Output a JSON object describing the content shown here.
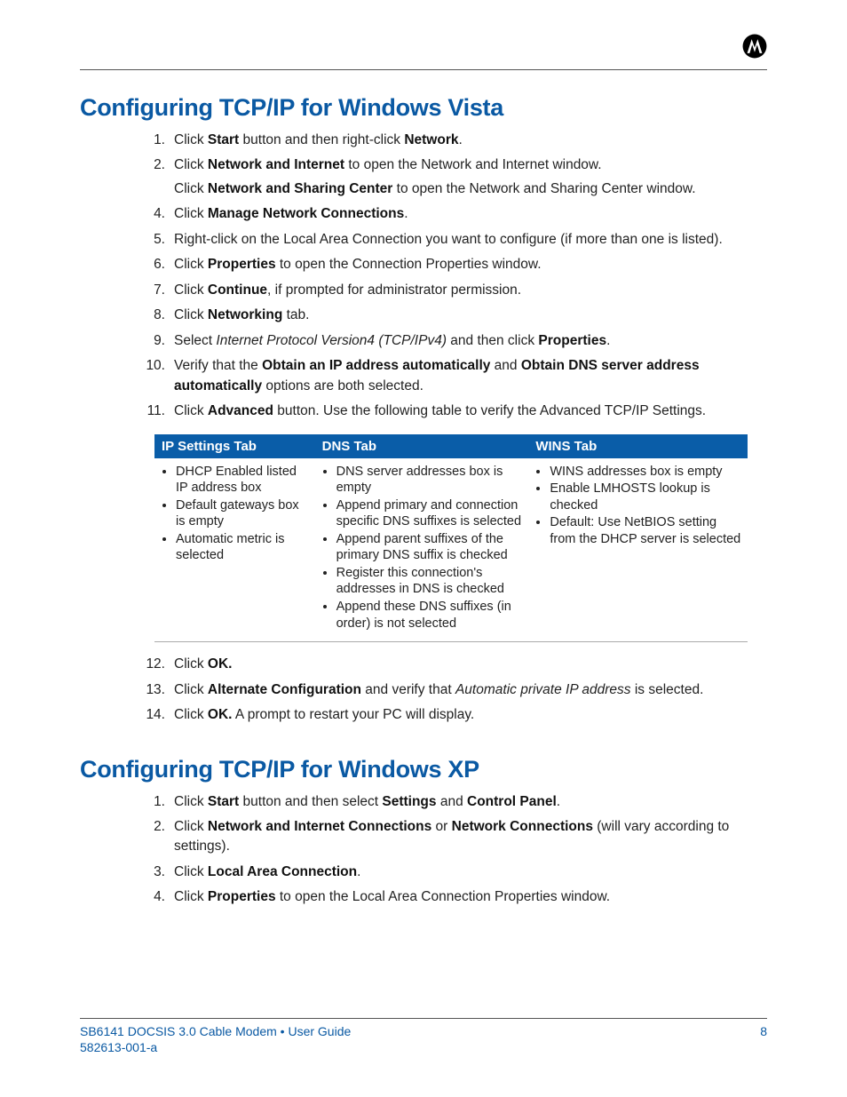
{
  "logo_name": "motorola-logo",
  "section1": {
    "title": "Configuring TCP/IP for Windows Vista",
    "steps_a": [
      {
        "n": "1.",
        "parts": [
          {
            "t": "Click "
          },
          {
            "t": "Start",
            "b": true
          },
          {
            "t": " button and then right-click "
          },
          {
            "t": "Network",
            "b": true
          },
          {
            "t": "."
          }
        ]
      },
      {
        "n": "2.",
        "parts": [
          {
            "t": "Click "
          },
          {
            "t": "Network and Internet",
            "b": true
          },
          {
            "t": " to open the Network and Internet window."
          }
        ],
        "sub": [
          {
            "t": "Click "
          },
          {
            "t": "Network and Sharing Center",
            "b": true
          },
          {
            "t": " to open the Network and Sharing Center window."
          }
        ]
      },
      {
        "n": "4.",
        "parts": [
          {
            "t": "Click "
          },
          {
            "t": "Manage Network Connections",
            "b": true
          },
          {
            "t": "."
          }
        ]
      },
      {
        "n": "5.",
        "parts": [
          {
            "t": "Right-click on the Local Area Connection you want to configure (if more than one is listed)."
          }
        ]
      },
      {
        "n": "6.",
        "parts": [
          {
            "t": "Click "
          },
          {
            "t": "Properties",
            "b": true
          },
          {
            "t": " to open the Connection Properties window."
          }
        ]
      },
      {
        "n": "7.",
        "parts": [
          {
            "t": "Click "
          },
          {
            "t": "Continue",
            "b": true
          },
          {
            "t": ", if prompted for administrator permission."
          }
        ]
      },
      {
        "n": "8.",
        "parts": [
          {
            "t": "Click "
          },
          {
            "t": "Networking",
            "b": true
          },
          {
            "t": " tab."
          }
        ]
      },
      {
        "n": "9.",
        "parts": [
          {
            "t": "Select "
          },
          {
            "t": "Internet Protocol Version4 (TCP/IPv4)",
            "i": true
          },
          {
            "t": " and then click "
          },
          {
            "t": "Properties",
            "b": true
          },
          {
            "t": "."
          }
        ]
      },
      {
        "n": "10.",
        "parts": [
          {
            "t": "Verify that the "
          },
          {
            "t": "Obtain an IP address automatically",
            "b": true
          },
          {
            "t": " and "
          },
          {
            "t": "Obtain DNS server address automatically",
            "b": true
          },
          {
            "t": " options are both selected."
          }
        ]
      },
      {
        "n": "11.",
        "parts": [
          {
            "t": "Click "
          },
          {
            "t": "Advanced",
            "b": true
          },
          {
            "t": " button. Use the following table to verify the Advanced TCP/IP Settings."
          }
        ]
      }
    ],
    "table": {
      "headers": [
        "IP Settings Tab",
        "DNS Tab",
        "WINS Tab"
      ],
      "col1": [
        "DHCP Enabled listed IP address box",
        "Default gateways box is empty",
        "Automatic metric is selected"
      ],
      "col2": [
        "DNS server addresses box is empty",
        "Append primary and connection specific DNS suffixes is selected",
        "Append parent suffixes of the primary DNS suffix is checked",
        "Register this connection's addresses in DNS is checked",
        "Append these DNS suffixes (in order) is not selected"
      ],
      "col3": [
        "WINS addresses box is empty",
        "Enable LMHOSTS lookup is checked",
        "Default: Use NetBIOS setting from the DHCP server is selected"
      ]
    },
    "steps_b": [
      {
        "n": "12.",
        "parts": [
          {
            "t": "Click "
          },
          {
            "t": "OK.",
            "b": true
          }
        ]
      },
      {
        "n": "13.",
        "parts": [
          {
            "t": "Click "
          },
          {
            "t": "Alternate Configuration",
            "b": true
          },
          {
            "t": " and verify that "
          },
          {
            "t": "Automatic private IP address",
            "i": true
          },
          {
            "t": " is selected."
          }
        ]
      },
      {
        "n": "14.",
        "parts": [
          {
            "t": "Click "
          },
          {
            "t": "OK.",
            "b": true
          },
          {
            "t": " A prompt to restart your PC will display."
          }
        ]
      }
    ]
  },
  "section2": {
    "title": "Configuring TCP/IP for Windows XP",
    "steps": [
      {
        "n": "1.",
        "parts": [
          {
            "t": "Click "
          },
          {
            "t": "Start",
            "b": true
          },
          {
            "t": " button and then select "
          },
          {
            "t": "Settings",
            "b": true
          },
          {
            "t": " and "
          },
          {
            "t": "Control Panel",
            "b": true
          },
          {
            "t": "."
          }
        ]
      },
      {
        "n": "2.",
        "parts": [
          {
            "t": "Click "
          },
          {
            "t": "Network and Internet Connections",
            "b": true
          },
          {
            "t": " or "
          },
          {
            "t": "Network Connections",
            "b": true
          },
          {
            "t": " (will vary according to settings)."
          }
        ]
      },
      {
        "n": "3.",
        "parts": [
          {
            "t": "Click "
          },
          {
            "t": "Local Area Connection",
            "b": true
          },
          {
            "t": "."
          }
        ]
      },
      {
        "n": "4.",
        "parts": [
          {
            "t": "Click "
          },
          {
            "t": "Properties",
            "b": true
          },
          {
            "t": " to open the Local Area Connection Properties window."
          }
        ]
      }
    ]
  },
  "footer": {
    "left": "SB6141 DOCSIS 3.0 Cable Modem • User Guide",
    "page": "8",
    "docnum": "582613-001-a"
  }
}
